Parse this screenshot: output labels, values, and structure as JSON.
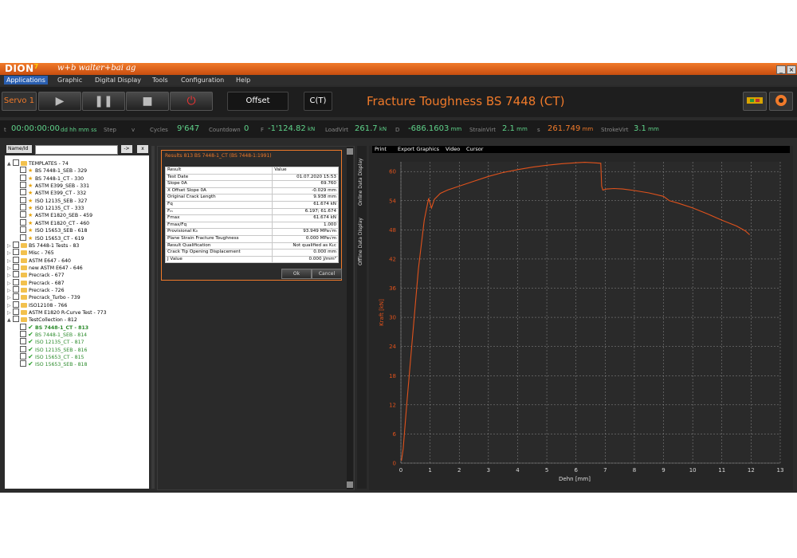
{
  "app": {
    "logo": "DION",
    "logo_mark": "7",
    "brand": "w+b  walter+bai ag",
    "window_buttons": [
      "_",
      "×"
    ]
  },
  "menu": [
    "Applications",
    "Graphic",
    "Digital Display",
    "Tools",
    "Configuration",
    "Help"
  ],
  "toolbar": {
    "servo": "Servo 1",
    "offset": "Offset",
    "specimen": "C(T)",
    "title": "Fracture Toughness BS 7448 (CT)"
  },
  "status": {
    "t_label": "t",
    "time": "00:00:00:00",
    "time_fmt": "dd hh mm ss",
    "step_label": "Step",
    "v_label": "v",
    "cycles_label": "Cycles",
    "cycles": "9'647",
    "countdown_label": "Countdown",
    "countdown": "0",
    "f_label": "F",
    "f": "-1'124.82",
    "f_unit": "kN",
    "loadvirt_label": "LoadVirt",
    "loadvirt": "261.7",
    "loadvirt_unit": "kN",
    "d_label": "D",
    "d": "-686.1603",
    "d_unit": "mm",
    "strainvirt_label": "StrainVirt",
    "strainvirt": "2.1",
    "strainvirt_unit": "mm",
    "s_label": "s",
    "s": "261.749",
    "s_unit": "mm",
    "strokevirt_label": "StrokeVirt",
    "strokevirt": "3.1",
    "strokevirt_unit": "mm"
  },
  "tree": {
    "name_label": "Name/Id",
    "go_btn": "->",
    "clear_btn": "x",
    "items": [
      {
        "label": "TEMPLATES - 74",
        "kind": "folder",
        "level": 0,
        "exp": "▲"
      },
      {
        "label": "BS 7448-1_SEB - 329",
        "kind": "star",
        "level": 1
      },
      {
        "label": "BS 7448-1_CT - 330",
        "kind": "star",
        "level": 1
      },
      {
        "label": "ASTM E399_SEB - 331",
        "kind": "star",
        "level": 1
      },
      {
        "label": "ASTM E399_CT - 332",
        "kind": "star",
        "level": 1
      },
      {
        "label": "ISO 12135_SEB - 327",
        "kind": "star",
        "level": 1
      },
      {
        "label": "ISO 12135_CT - 333",
        "kind": "star",
        "level": 1
      },
      {
        "label": "ASTM E1820_SEB - 459",
        "kind": "star",
        "level": 1
      },
      {
        "label": "ASTM E1820_CT - 460",
        "kind": "star",
        "level": 1
      },
      {
        "label": "ISO 15653_SEB - 618",
        "kind": "star",
        "level": 1
      },
      {
        "label": "ISO 15653_CT - 619",
        "kind": "star",
        "level": 1
      },
      {
        "label": "BS 7448-1 Tests - 83",
        "kind": "folder",
        "level": 0,
        "exp": "▷"
      },
      {
        "label": "Misc - 765",
        "kind": "folder",
        "level": 0,
        "exp": "▷"
      },
      {
        "label": "ASTM E647 - 640",
        "kind": "folder",
        "level": 0,
        "exp": "▷"
      },
      {
        "label": "new ASTM E647 - 646",
        "kind": "folder",
        "level": 0,
        "exp": "▷"
      },
      {
        "label": "Precrack - 677",
        "kind": "folder",
        "level": 0,
        "exp": "▷"
      },
      {
        "label": "Precrack - 687",
        "kind": "folder",
        "level": 0,
        "exp": "▷"
      },
      {
        "label": "Precrack - 726",
        "kind": "folder",
        "level": 0,
        "exp": "▷"
      },
      {
        "label": "Precrack_Turbo - 739",
        "kind": "folder",
        "level": 0,
        "exp": "▷"
      },
      {
        "label": "ISO12108 - 766",
        "kind": "folder",
        "level": 0,
        "exp": "▷"
      },
      {
        "label": "ASTM E1820 R-Curve Test - 773",
        "kind": "folder",
        "level": 0,
        "exp": "▷"
      },
      {
        "label": "TestCollection - 812",
        "kind": "folder",
        "level": 0,
        "exp": "▲"
      },
      {
        "label": "BS 7448-1_CT - 813",
        "kind": "check",
        "level": 1,
        "bold": true
      },
      {
        "label": "BS 7448-1_SEB - 814",
        "kind": "check",
        "level": 1
      },
      {
        "label": "ISO 12135_CT - 817",
        "kind": "check",
        "level": 1
      },
      {
        "label": "ISO 12135_SEB - 816",
        "kind": "check",
        "level": 1
      },
      {
        "label": "ISO 15653_CT - 815",
        "kind": "check",
        "level": 1
      },
      {
        "label": "ISO 15653_SEB - 818",
        "kind": "check",
        "level": 1
      }
    ]
  },
  "results": {
    "title": "Results 813 BS 7448-1_CT (BS 7448-1:1991)",
    "col_result": "Result",
    "col_value": "Value",
    "rows": [
      [
        "Test Date",
        "01.07.2020 15:53"
      ],
      [
        "Slope 0A",
        "69.760"
      ],
      [
        "X Offset Slope 0A",
        "-0.029 mm"
      ],
      [
        "Original Crack Length",
        "9.938 mm"
      ],
      [
        "Fq",
        "61.674 kN"
      ],
      [
        "Fₘ",
        "6.197; 61.674"
      ],
      [
        "Fmax",
        "61.674 kN"
      ],
      [
        "Fmax/Fq",
        "1.000"
      ],
      [
        "Provisional K₀",
        "93.949 MPa√m"
      ],
      [
        "Plane Strain Fracture Toughness",
        "0.000 MPa√m"
      ],
      [
        "Result Qualification",
        "Not qualified as K₁c"
      ],
      [
        "Crack Tip Opening Displacement",
        "0.000 mm"
      ],
      [
        "J Value",
        "0.000 J/mm²"
      ]
    ],
    "ok": "Ok",
    "cancel": "Cancel"
  },
  "side_tabs": [
    "Online Data Display",
    "Offline Data Display"
  ],
  "chart_tools": [
    "Print",
    "Export Graphics",
    "Video",
    "Cursor"
  ],
  "colors": {
    "accent": "#f07a2a",
    "value_green": "#5fd38a"
  },
  "chart_data": {
    "type": "line",
    "xlabel": "Dehn [mm]",
    "ylabel": "Kraft [kN]",
    "xlim": [
      0,
      13
    ],
    "ylim": [
      0,
      62
    ],
    "xticks": [
      0,
      1,
      2,
      3,
      4,
      5,
      6,
      7,
      8,
      9,
      10,
      11,
      12,
      13
    ],
    "yticks": [
      0,
      6,
      12,
      18,
      24,
      30,
      36,
      42,
      48,
      54,
      60
    ],
    "grid": true,
    "series": [
      {
        "color": "#e0521c",
        "x": [
          0.02,
          0.08,
          0.2,
          0.4,
          0.6,
          0.8,
          0.95,
          1.05,
          1.15,
          1.2,
          1.35,
          1.6,
          2.0,
          2.5,
          3.0,
          3.5,
          4.0,
          4.5,
          5.0,
          5.5,
          6.0,
          6.3,
          6.6,
          6.85,
          6.88,
          6.92,
          7.05,
          7.3,
          7.6,
          8.0,
          8.5,
          9.0,
          9.2,
          9.5,
          10.0,
          10.5,
          11.0,
          11.5,
          11.8,
          11.95
        ],
        "y": [
          0.5,
          3,
          12,
          26,
          40,
          50,
          54.5,
          52.5,
          54.3,
          54.6,
          55.5,
          56.2,
          57.0,
          58.0,
          59.0,
          59.8,
          60.4,
          60.9,
          61.3,
          61.6,
          61.8,
          61.9,
          61.8,
          61.7,
          57,
          56.2,
          56.4,
          56.5,
          56.4,
          56.1,
          55.6,
          54.9,
          54.0,
          53.5,
          52.5,
          51.3,
          50.0,
          48.8,
          47.8,
          47.0
        ]
      }
    ]
  }
}
